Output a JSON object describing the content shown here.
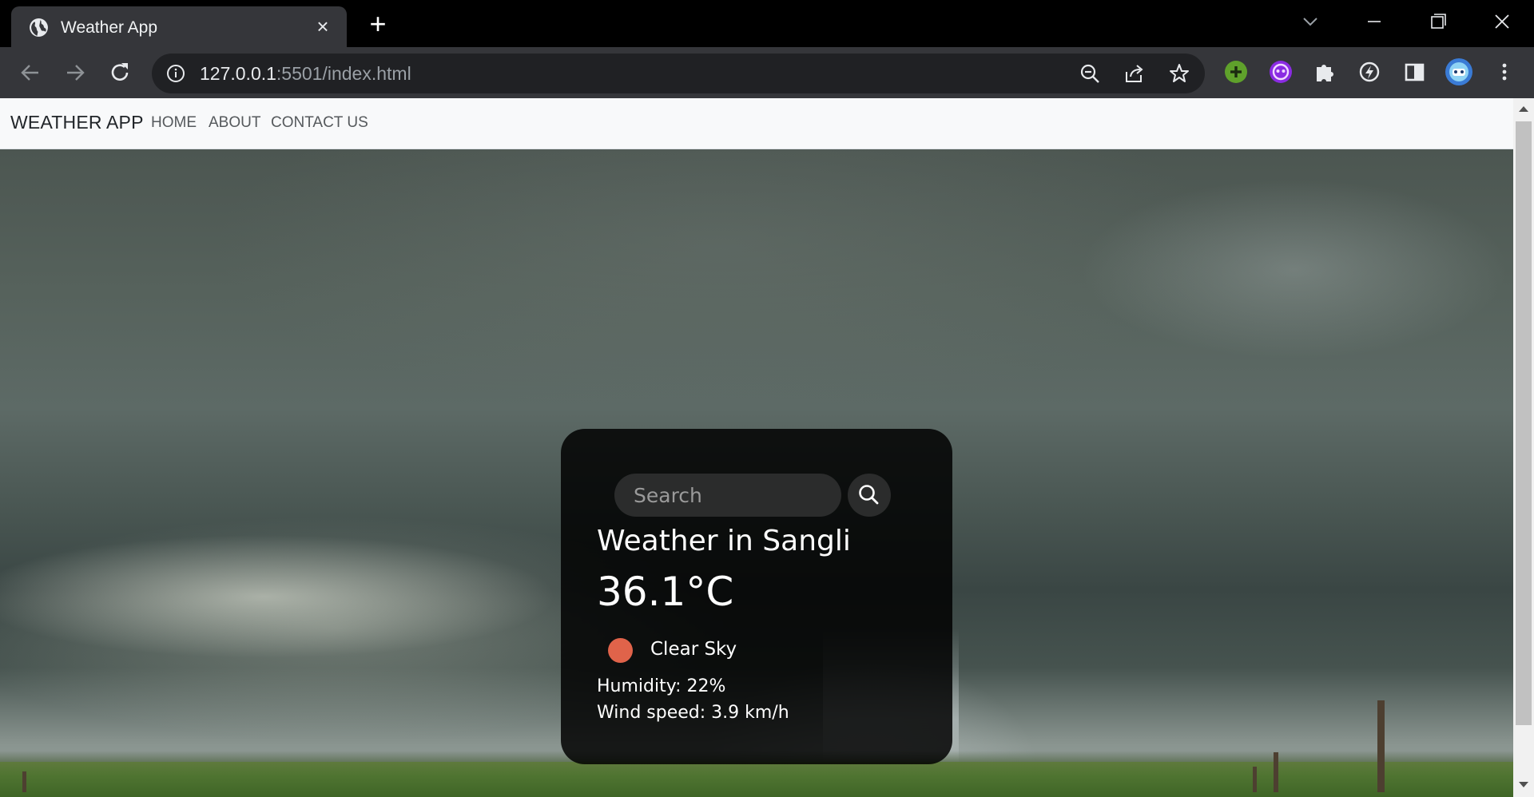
{
  "browser": {
    "tab": {
      "title": "Weather App",
      "favicon": "globe-icon",
      "close": "×"
    },
    "new_tab": "+",
    "url_host": "127.0.0.1",
    "url_rest": ":5501/index.html",
    "toolbar_icons": [
      "back-arrow-icon",
      "forward-arrow-icon",
      "reload-icon",
      "zoom-out-icon",
      "share-icon",
      "star-icon",
      "extension-plus-icon",
      "extension-purple-icon",
      "puzzle-icon",
      "lightning-icon",
      "sidebar-icon",
      "profile-avatar",
      "menu-dots-icon"
    ]
  },
  "navbar": {
    "brand": "WEATHER APP",
    "links": [
      "HOME",
      "ABOUT",
      "CONTACT US"
    ]
  },
  "weather": {
    "search_placeholder": "Search",
    "city_line": "Weather in Sangli",
    "temperature": "36.1°C",
    "description": "Clear Sky",
    "humidity": "Humidity: 22%",
    "wind": "Wind speed: 3.9 km/h"
  },
  "colors": {
    "navbar_bg": "#f8f9fa",
    "card_bg": "#000000d6",
    "weather_icon": "#e0634a"
  }
}
